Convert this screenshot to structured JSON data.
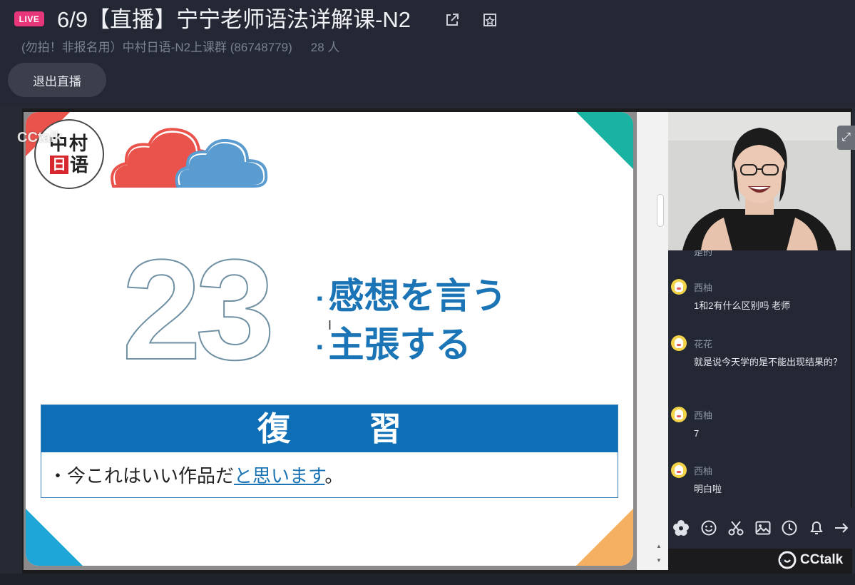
{
  "header": {
    "live_badge": "LIVE",
    "title": "6/9【直播】宁宁老师语法详解课-N2",
    "group_name": "(勿拍！非报名用）中村日语-N2上课群 (86748779)",
    "member_count": "28 人",
    "exit_label": "退出直播"
  },
  "slide": {
    "watermark": "CCtalk",
    "logo_top": "中村",
    "logo_red": "日",
    "logo_bot": "语",
    "lesson_number": "23",
    "topics": [
      "感想を言う",
      "主張する"
    ],
    "bullet": "▪",
    "review_title": "復習",
    "review_prefix": "・今これはいい作品だ",
    "review_highlight": "と思います",
    "review_suffix": "。"
  },
  "chat": {
    "clipped_text": "是的",
    "messages": [
      {
        "name": "西柚",
        "text": "1和2有什么区别吗 老师"
      },
      {
        "name": "花花",
        "text": "就是说今天学的是不能出现结果的？"
      },
      {
        "name": "西柚",
        "text": "7"
      },
      {
        "name": "西柚",
        "text": "明白啦"
      }
    ]
  },
  "toolbar": {
    "icons": [
      "flower-icon",
      "emoji-icon",
      "scissors-icon",
      "image-icon",
      "clock-icon",
      "bell-icon",
      "arrow-right-icon"
    ]
  },
  "brand": {
    "name": "CCtalk"
  },
  "colors": {
    "live": "#e8367a",
    "slide_blue": "#1a74b5",
    "review_bar": "#0f6fb6",
    "cloud_red": "#e9534c",
    "cloud_blue": "#5a9bd0",
    "corner_teal": "#1ab2a0",
    "corner_cyan": "#1ea7d6",
    "corner_orange": "#f5b061"
  }
}
